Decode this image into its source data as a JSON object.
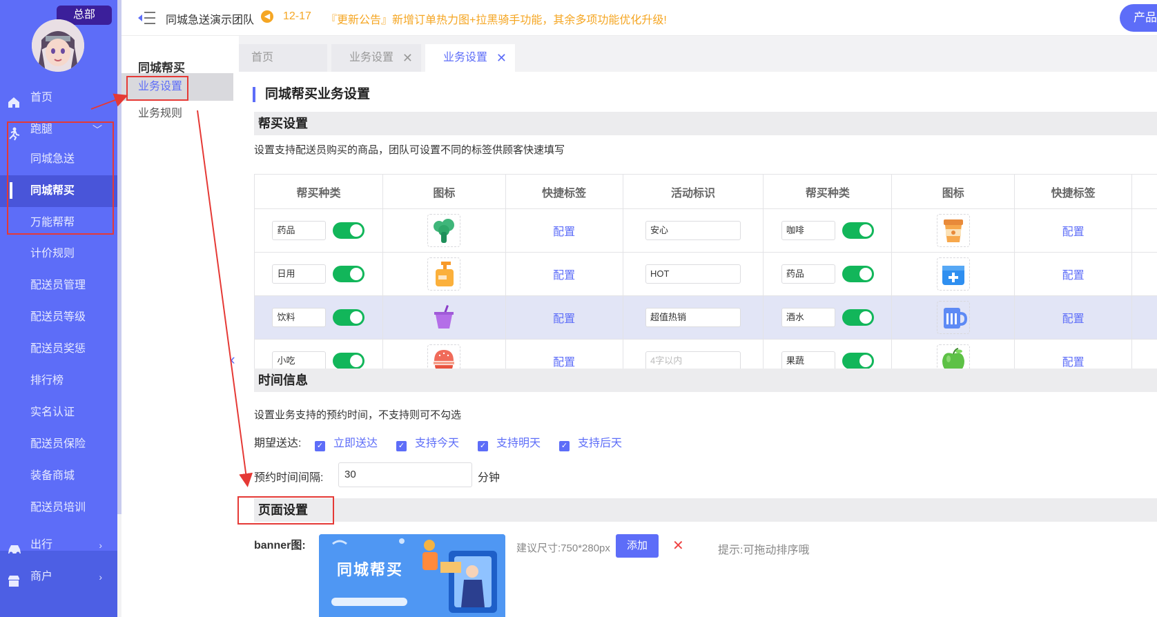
{
  "sidebar": {
    "badge": "总部",
    "home": "首页",
    "errand": "跑腿",
    "errand_sub": [
      "同城急送",
      "同城帮买",
      "万能帮帮"
    ],
    "items": [
      "计价规则",
      "配送员管理",
      "配送员等级",
      "配送员奖惩",
      "排行榜",
      "实名认证",
      "配送员保险",
      "装备商城",
      "配送员培训"
    ],
    "travel": "出行",
    "merchant": "商户"
  },
  "topbar": {
    "team": "同城急送演示团队",
    "notice_date": "12-17",
    "notice_text": "『更新公告』新增订单热力图+拉黑骑手功能，其余多项功能优化升级!",
    "product_button": "产品"
  },
  "subnav": {
    "title": "同城帮买",
    "items": [
      "业务设置",
      "业务规则"
    ]
  },
  "tabs": [
    "首页",
    "业务设置",
    "业务设置"
  ],
  "page": {
    "title": "同城帮买业务设置",
    "buy_section": "帮买设置",
    "buy_desc": "设置支持配送员购买的商品，团队可设置不同的标签供顾客快速填写",
    "columns": [
      "帮买种类",
      "图标",
      "快捷标签",
      "活动标识",
      "帮买种类",
      "图标",
      "快捷标签"
    ],
    "config_link": "配置",
    "rows": [
      {
        "left_name": "药品",
        "left_icon": "broccoli-icon",
        "left_tag": "安心",
        "right_name": "咖啡",
        "right_icon": "coffee-cup-icon"
      },
      {
        "left_name": "日用",
        "left_icon": "soap-dispenser-icon",
        "left_tag": "HOT",
        "right_name": "药品",
        "right_icon": "medicine-box-icon"
      },
      {
        "left_name": "饮料",
        "left_icon": "drink-cup-icon",
        "left_tag": "超值热销",
        "right_name": "酒水",
        "right_icon": "beer-mug-icon"
      },
      {
        "left_name": "小吃",
        "left_icon": "burger-icon",
        "left_tag_placeholder": "4字以内",
        "right_name": "果蔬",
        "right_icon": "apple-icon"
      }
    ],
    "time_section": "时间信息",
    "time_desc": "设置业务支持的预约时间，不支持则可不勾选",
    "expect_label": "期望送达:",
    "options": [
      "立即送达",
      "支持今天",
      "支持明天",
      "支持后天"
    ],
    "interval_label": "预约时间间隔:",
    "interval_value": "30",
    "interval_unit": "分钟",
    "page_section": "页面设置",
    "banner_label": "banner图:",
    "banner_text": "同城帮买",
    "size_hint": "建议尺寸:750*280px",
    "add_button": "添加",
    "drag_hint": "提示:可拖动排序哦"
  },
  "colors": {
    "primary": "#5d6df8",
    "toggle_on": "#12b65a",
    "notice": "#f5a623",
    "annotation": "#e53935"
  }
}
